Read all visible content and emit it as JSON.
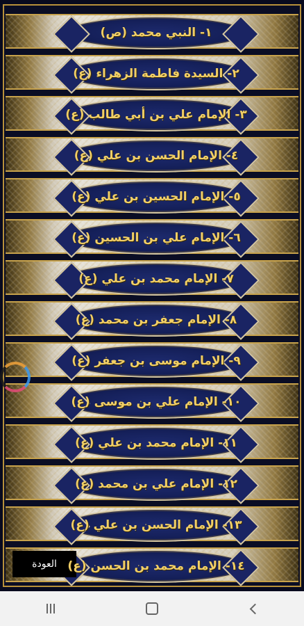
{
  "items": [
    {
      "label": "١- النبي محمد (ص)"
    },
    {
      "label": "٢- السيدة فاطمة الزهراء (ع)"
    },
    {
      "label": "٣- الإمام علي بن أبي طالب (ع)"
    },
    {
      "label": "٤- الإمام الحسن بن علي (ع)"
    },
    {
      "label": "٥- الإمام الحسين بن علي (ع)"
    },
    {
      "label": "٦- الإمام علي بن الحسين (ع)"
    },
    {
      "label": "٧- الإمام محمد بن علي (ع)"
    },
    {
      "label": "٨- الإمام جعفر بن محمد (ع)"
    },
    {
      "label": "٩- الإمام موسى بن جعفر (ع)"
    },
    {
      "label": "١٠- الإمام علي بن موسى (ع)"
    },
    {
      "label": "١١- الإمام محمد بن علي (ع)"
    },
    {
      "label": "١٢- الإمام علي بن محمد (ع)"
    },
    {
      "label": "١٣- الإمام الحسن بن علي (ع)"
    },
    {
      "label": "١٤- الإمام محمد بن الحسن (ع)"
    }
  ],
  "back_button": {
    "label": "العودة"
  },
  "navbar": {
    "recent_icon": "recent-apps-icon",
    "home_icon": "home-icon",
    "back_icon": "back-icon"
  },
  "colors": {
    "accent_gold": "#f1cf66",
    "cartouche_blue": "#15205a",
    "frame_gold": "#b8913a"
  }
}
